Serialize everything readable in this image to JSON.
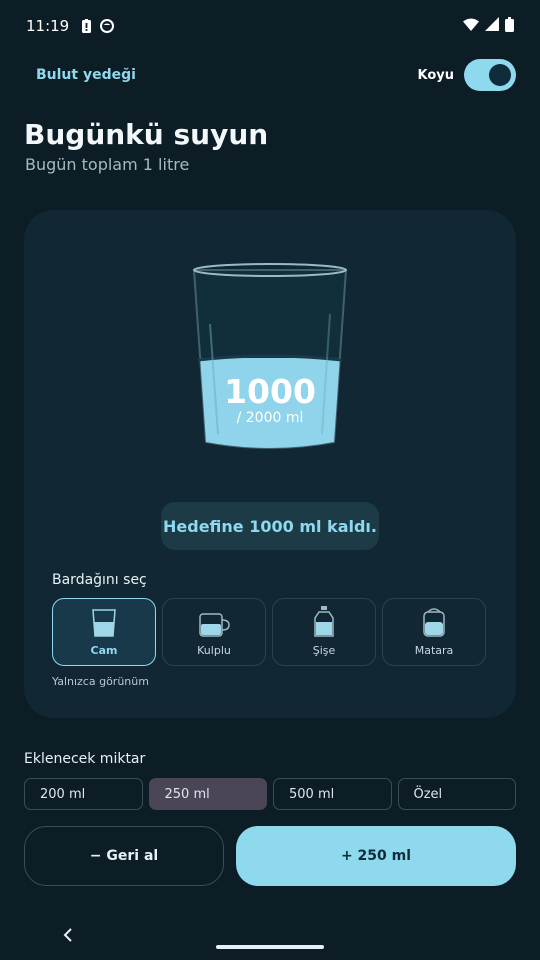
{
  "status": {
    "time": "11:19"
  },
  "header": {
    "cloud_backup": "Bulut yedeği",
    "theme_label": "Koyu",
    "theme_dark_on": true
  },
  "title": "Bugünkü suyun",
  "subtitle": "Bugün toplam 1 litre",
  "glass": {
    "value": "1000",
    "goal": "/ 2000 ml",
    "fill_fraction": 0.5
  },
  "remaining": "Hedefine 1000 ml kaldı.",
  "cup_section": {
    "label": "Bardağını seç",
    "options": [
      {
        "name": "Cam",
        "selected": true
      },
      {
        "name": "Kulplu",
        "selected": false
      },
      {
        "name": "Şişe",
        "selected": false
      },
      {
        "name": "Matara",
        "selected": false
      }
    ],
    "note": "Yalnızca görünüm"
  },
  "amount_section": {
    "label": "Eklenecek miktar",
    "options": [
      {
        "label": "200 ml",
        "selected": false
      },
      {
        "label": "250 ml",
        "selected": true
      },
      {
        "label": "500 ml",
        "selected": false
      },
      {
        "label": "Özel",
        "selected": false
      }
    ]
  },
  "actions": {
    "undo": "−  Geri al",
    "add": "+  250 ml"
  },
  "colors": {
    "background": "#0c1d26",
    "card": "#112834",
    "accent": "#8fd9ef",
    "selected_amount": "#4b4558"
  },
  "icons": {
    "battery_alert": "battery-alert-icon",
    "app_notification": "app-notification-icon",
    "wifi": "wifi-icon",
    "signal": "signal-icon",
    "battery": "battery-icon",
    "back": "back-icon"
  }
}
